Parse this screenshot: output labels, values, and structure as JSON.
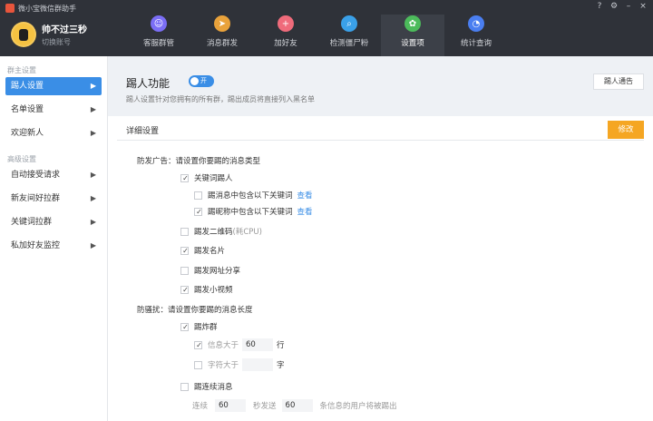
{
  "window": {
    "title": "微小宝微信群助手"
  },
  "profile": {
    "name": "帅不过三秒",
    "switch_label": "切换账号"
  },
  "nav": [
    {
      "label": "客服群管",
      "icon": "group-icon",
      "color": "#7b6ef6"
    },
    {
      "label": "消息群发",
      "icon": "send-icon",
      "color": "#e9a23b"
    },
    {
      "label": "加好友",
      "icon": "add-friend-icon",
      "color": "#ef6b7b"
    },
    {
      "label": "检测僵尸粉",
      "icon": "detect-icon",
      "color": "#3aa0e8"
    },
    {
      "label": "设置项",
      "icon": "settings-icon",
      "color": "#4cbb5b"
    },
    {
      "label": "统计查询",
      "icon": "stats-icon",
      "color": "#4a7ef0"
    }
  ],
  "sidebar": {
    "group1": "群主设置",
    "items1": [
      {
        "label": "踢人设置"
      },
      {
        "label": "名单设置"
      },
      {
        "label": "欢迎新人"
      }
    ],
    "group2": "高级设置",
    "items2": [
      {
        "label": "自动接受请求"
      },
      {
        "label": "新友间好拉群"
      },
      {
        "label": "关键词拉群"
      },
      {
        "label": "私加好友监控"
      }
    ]
  },
  "feature": {
    "title": "踢人功能",
    "toggle_label": "开",
    "description": "踢人设置针对您拥有的所有群，踢出成员将直接列入黑名单",
    "notice_button": "踢人通告"
  },
  "detail": {
    "title": "详细设置",
    "modify_button": "修改",
    "ads_heading": "防发广告：请设置你要踢的消息类型",
    "keyword_kick": "关键词踢人",
    "msg_contains": "踢消息中包含以下关键词",
    "nick_contains": "踢昵称中包含以下关键词",
    "view_link": "查看",
    "qrcode": "踢发二维码",
    "qrcode_note": "(耗CPU)",
    "card": "踢发名片",
    "url_share": "踢发网址分享",
    "video": "踢发小视频",
    "spam_heading": "防骚扰：请设置你要踢的消息长度",
    "spam_kick": "踢炸群",
    "info_gt": "信息大于",
    "info_value": "60",
    "info_unit": "行",
    "chars_gt": "字符大于",
    "chars_value": "",
    "chars_unit": "字",
    "continuous": "踢连续消息",
    "cont_prefix": "连续",
    "cont_value1": "60",
    "cont_mid": "秒发送",
    "cont_value2": "60",
    "cont_suffix": "条信息的用户将被踢出"
  }
}
